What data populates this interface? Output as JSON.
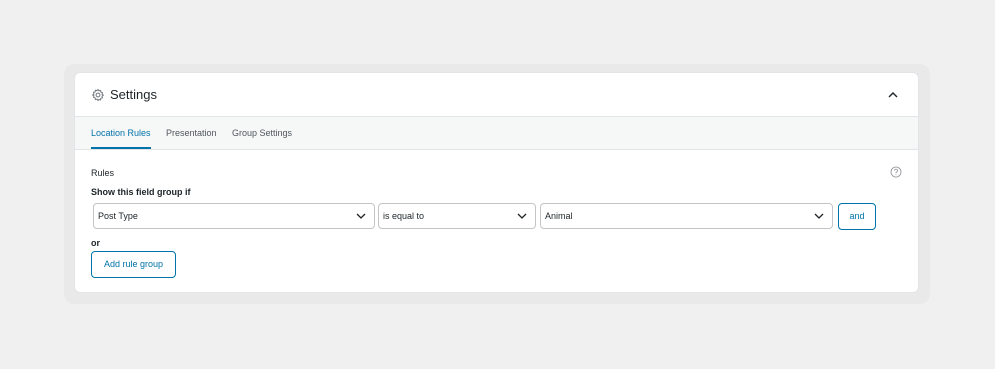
{
  "settings": {
    "title": "Settings",
    "icons": {
      "header": "gear-icon",
      "collapse": "chevron-up-icon",
      "help": "question-circle-icon",
      "select": "chevron-down-icon"
    },
    "tabs": [
      {
        "label": "Location Rules",
        "active": true
      },
      {
        "label": "Presentation",
        "active": false
      },
      {
        "label": "Group Settings",
        "active": false
      }
    ],
    "rules_label": "Rules",
    "show_if_label": "Show this field group if",
    "rule": {
      "param": "Post Type",
      "operator": "is equal to",
      "value": "Animal"
    },
    "and_label": "and",
    "or_label": "or",
    "add_rule_group_label": "Add rule group"
  },
  "colors": {
    "accent": "#0073aa",
    "background": "#f0f0f1",
    "panel": "#ffffff"
  }
}
